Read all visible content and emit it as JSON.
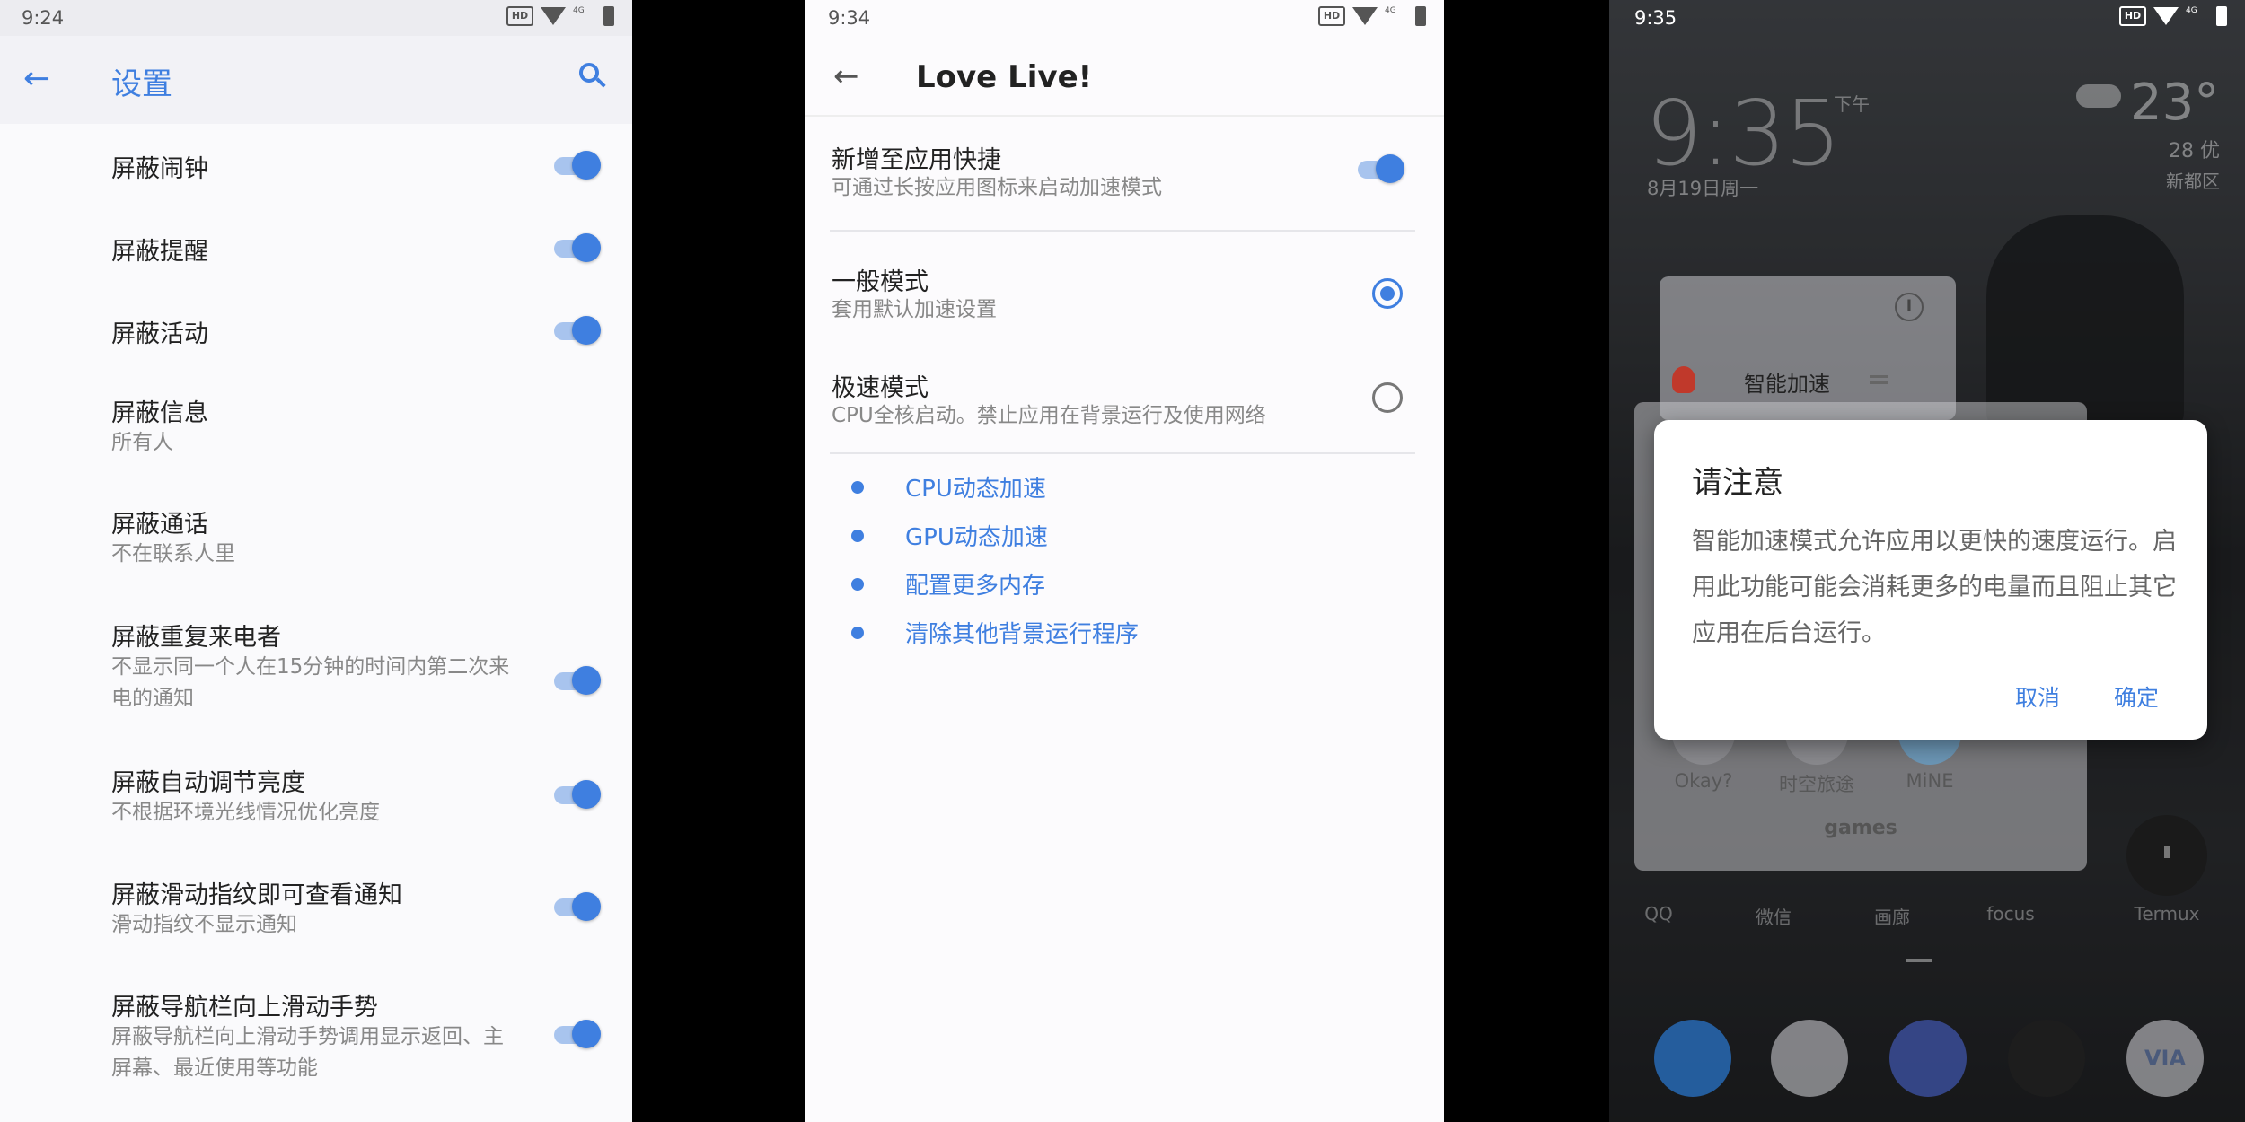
{
  "panel1": {
    "status": {
      "time": "9:24",
      "hd": "HD",
      "net": "4G"
    },
    "title": "设置",
    "rows": [
      {
        "title": "屏蔽闹钟",
        "sub": "",
        "toggle": true
      },
      {
        "title": "屏蔽提醒",
        "sub": "",
        "toggle": true
      },
      {
        "title": "屏蔽活动",
        "sub": "",
        "toggle": true
      },
      {
        "title": "屏蔽信息",
        "sub": "所有人",
        "toggle": false
      },
      {
        "title": "屏蔽通话",
        "sub": "不在联系人里",
        "toggle": false
      },
      {
        "title": "屏蔽重复来电者",
        "sub": "不显示同一个人在15分钟的时间内第二次来电的通知",
        "toggle": true
      },
      {
        "title": "屏蔽自动调节亮度",
        "sub": "不根据环境光线情况优化亮度",
        "toggle": true
      },
      {
        "title": "屏蔽滑动指纹即可查看通知",
        "sub": "滑动指纹不显示通知",
        "toggle": true
      },
      {
        "title": "屏蔽导航栏向上滑动手势",
        "sub": "屏蔽导航栏向上滑动手势调用显示返回、主屏幕、最近使用等功能",
        "toggle": true
      }
    ]
  },
  "panel2": {
    "status": {
      "time": "9:34",
      "hd": "HD",
      "net": "4G"
    },
    "title": "Love Live!",
    "shortcut": {
      "title": "新增至应用快捷",
      "sub": "可通过长按应用图标来启动加速模式",
      "on": true
    },
    "modes": [
      {
        "title": "一般模式",
        "sub": "套用默认加速设置",
        "selected": true
      },
      {
        "title": "极速模式",
        "sub": "CPU全核启动。禁止应用在背景运行及使用网络",
        "selected": false
      }
    ],
    "features": [
      "CPU动态加速",
      "GPU动态加速",
      "配置更多内存",
      "清除其他背景运行程序"
    ]
  },
  "panel3": {
    "status": {
      "time": "9:35",
      "hd": "HD",
      "net": "4G"
    },
    "clock": "9:35",
    "ampm": "下午",
    "date": "8月19日周一",
    "weather": {
      "temp": "23°",
      "low": "28 优",
      "location": "新都区"
    },
    "card_label": "智能加速",
    "folder": {
      "name": "games",
      "apps": [
        "Okay?",
        "时空旅途",
        "MiNE"
      ]
    },
    "dock_labels": [
      "QQ",
      "微信",
      "画廊",
      "focus",
      "Termux"
    ],
    "dialog": {
      "title": "请注意",
      "body": "智能加速模式允许应用以更快的速度运行。启用此功能可能会消耗更多的电量而且阻止其它应用在后台运行。",
      "cancel": "取消",
      "ok": "确定"
    },
    "via_label": "VIA"
  },
  "colors": {
    "accent": "#3f7fe0",
    "rocket": "#c0392b"
  }
}
